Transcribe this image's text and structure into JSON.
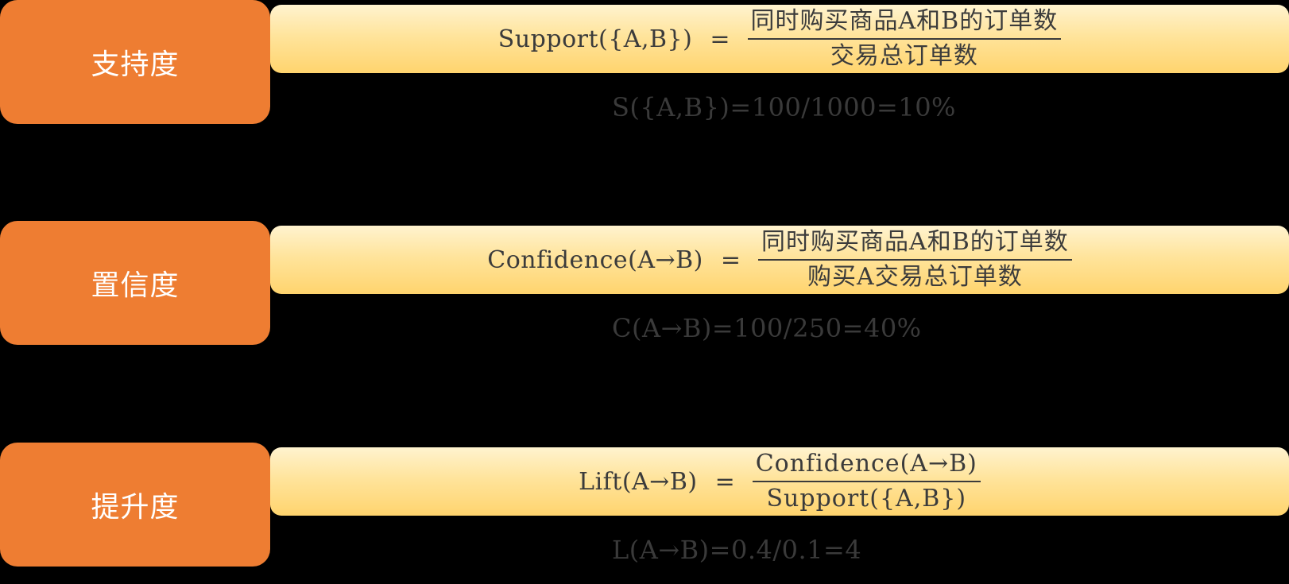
{
  "rows": [
    {
      "label": "支持度",
      "formula_lhs": "Support({A,B})",
      "equals": "=",
      "numerator": "同时购买商品A和B的订单数",
      "denominator": "交易总订单数",
      "example": "S({A,B})=100/1000=10%"
    },
    {
      "label": "置信度",
      "formula_lhs": "Confidence(A→B)",
      "equals": "=",
      "numerator": "同时购买商品A和B的订单数",
      "denominator": "购买A交易总订单数",
      "example": "C(A→B)=100/250=40%"
    },
    {
      "label": "提升度",
      "formula_lhs": "Lift(A→B)",
      "equals": "=",
      "numerator": "Confidence(A→B)",
      "denominator": "Support({A,B})",
      "example": "L(A→B)=0.4/0.1=4"
    }
  ],
  "colors": {
    "label_fill": "#ee7d32",
    "bar_top": "#fff3cf",
    "bar_bottom": "#ffd46e",
    "background": "#000000"
  }
}
